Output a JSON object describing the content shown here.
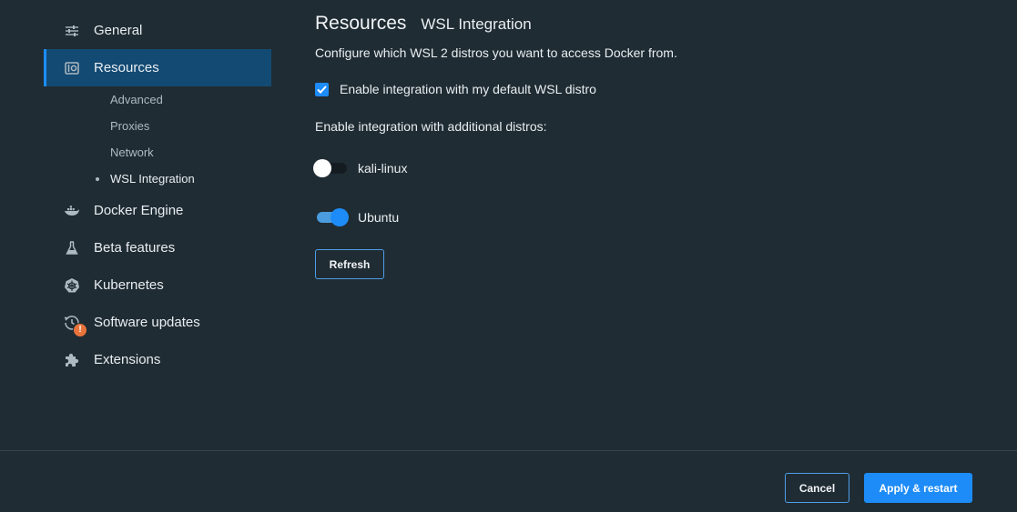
{
  "sidebar": {
    "items": [
      {
        "label": "General",
        "icon": "sliders-icon"
      },
      {
        "label": "Resources",
        "icon": "resources-icon",
        "active": true
      },
      {
        "label": "Docker Engine",
        "icon": "whale-icon"
      },
      {
        "label": "Beta features",
        "icon": "flask-icon"
      },
      {
        "label": "Kubernetes",
        "icon": "kubernetes-icon"
      },
      {
        "label": "Software updates",
        "icon": "update-history-icon",
        "badge": "!"
      },
      {
        "label": "Extensions",
        "icon": "puzzle-icon"
      }
    ],
    "subitems": [
      {
        "label": "Advanced"
      },
      {
        "label": "Proxies"
      },
      {
        "label": "Network"
      },
      {
        "label": "WSL Integration",
        "current": true
      }
    ]
  },
  "main": {
    "title": "Resources",
    "subtitle": "WSL Integration",
    "description": "Configure which WSL 2 distros you want to access Docker from.",
    "default_distro": {
      "label": "Enable integration with my default WSL distro",
      "checked": true
    },
    "additional_label": "Enable integration with additional distros:",
    "distros": [
      {
        "name": "kali-linux",
        "enabled": false
      },
      {
        "name": "Ubuntu",
        "enabled": true
      }
    ],
    "refresh_label": "Refresh"
  },
  "footer": {
    "cancel_label": "Cancel",
    "apply_label": "Apply & restart"
  },
  "colors": {
    "background": "#202c33",
    "accent": "#1d8cf8",
    "active_nav": "#134a73",
    "badge": "#e8743b"
  }
}
